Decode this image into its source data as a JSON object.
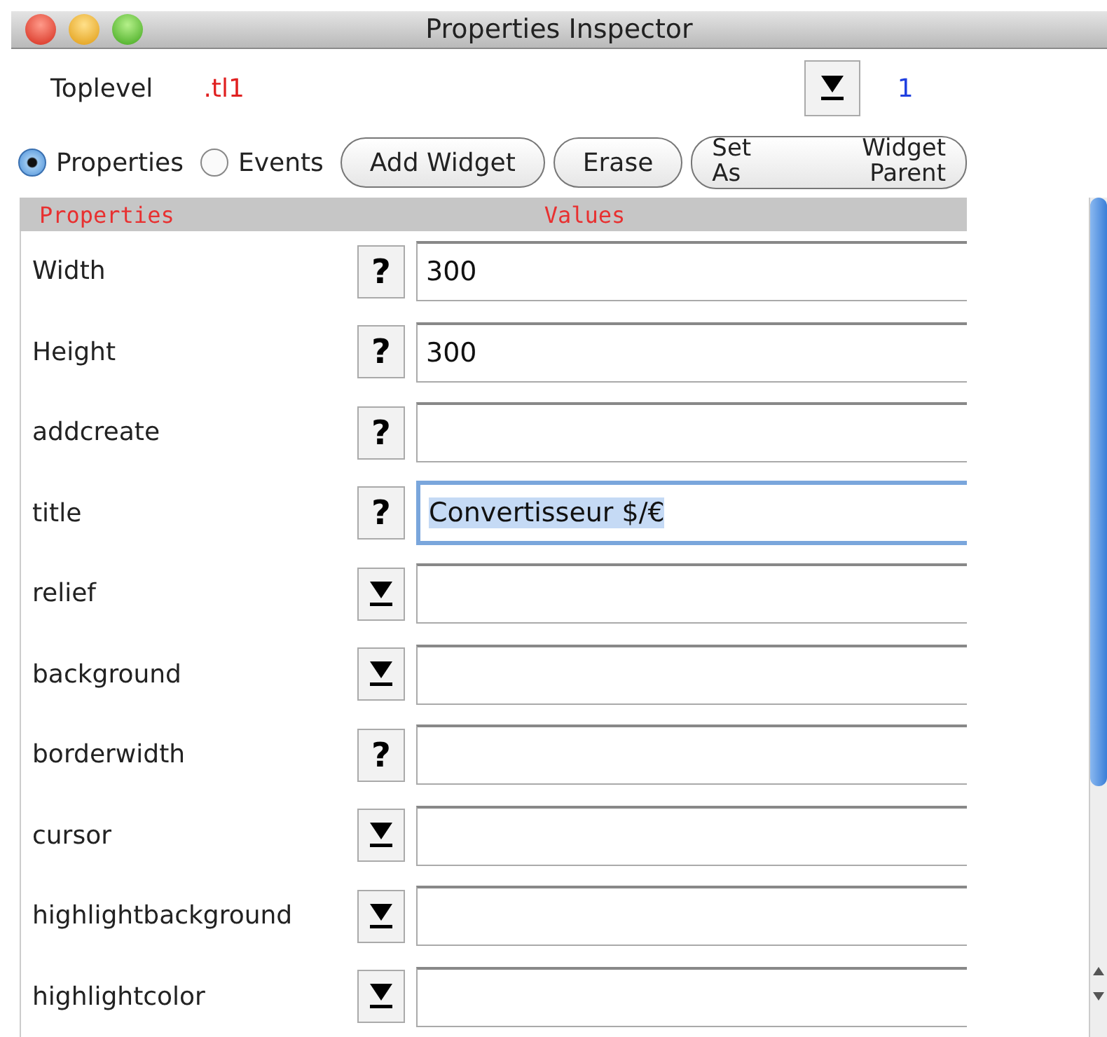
{
  "window": {
    "title": "Properties Inspector"
  },
  "toplevel": {
    "label": "Toplevel",
    "path": ".tl1",
    "menu_value": "1"
  },
  "modes": [
    {
      "label": "Properties",
      "selected": true
    },
    {
      "label": "Events",
      "selected": false
    }
  ],
  "buttons": [
    {
      "lines": [
        "Add Widget"
      ]
    },
    {
      "lines": [
        "Erase"
      ]
    },
    {
      "lines": [
        "Set",
        "Widget",
        "As",
        "Parent"
      ]
    }
  ],
  "table": {
    "columns": [
      "Properties",
      "Values"
    ],
    "rows": [
      {
        "name": "Width",
        "kind": "help",
        "button": "?",
        "value": "300",
        "focused": false
      },
      {
        "name": "Height",
        "kind": "help",
        "button": "?",
        "value": "300",
        "focused": false
      },
      {
        "name": "addcreate",
        "kind": "help",
        "button": "?",
        "value": "",
        "focused": false
      },
      {
        "name": "title",
        "kind": "help",
        "button": "?",
        "value": "Convertisseur $/€",
        "focused": true
      },
      {
        "name": "relief",
        "kind": "menu",
        "value": "",
        "focused": false
      },
      {
        "name": "background",
        "kind": "menu",
        "value": "",
        "focused": false
      },
      {
        "name": "borderwidth",
        "kind": "help",
        "button": "?",
        "value": "",
        "focused": false
      },
      {
        "name": "cursor",
        "kind": "menu",
        "value": "",
        "focused": false
      },
      {
        "name": "highlightbackground",
        "kind": "menu",
        "value": "",
        "focused": false
      },
      {
        "name": "highlightcolor",
        "kind": "menu",
        "value": "",
        "focused": false
      }
    ]
  }
}
